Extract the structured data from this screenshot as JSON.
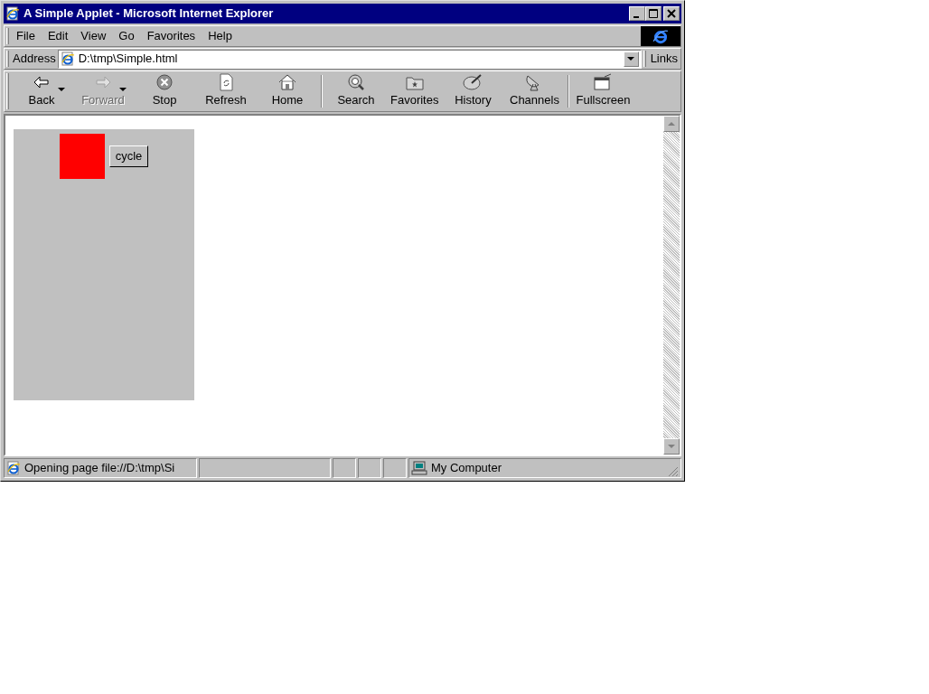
{
  "window": {
    "title": "A Simple Applet - Microsoft Internet Explorer"
  },
  "menu": [
    {
      "label": "File"
    },
    {
      "label": "Edit"
    },
    {
      "label": "View"
    },
    {
      "label": "Go"
    },
    {
      "label": "Favorites"
    },
    {
      "label": "Help"
    }
  ],
  "address": {
    "label": "Address",
    "value": "D:\\tmp\\Simple.html"
  },
  "links": "Links",
  "toolbar": [
    [
      {
        "label": "Back",
        "disabled": false,
        "has_menu": true
      },
      {
        "label": "Forward",
        "disabled": true,
        "has_menu": true
      },
      {
        "label": "Stop",
        "disabled": false,
        "has_menu": false
      },
      {
        "label": "Refresh",
        "disabled": false,
        "has_menu": false
      },
      {
        "label": "Home",
        "disabled": false,
        "has_menu": false
      }
    ],
    [
      {
        "label": "Search",
        "disabled": false,
        "has_menu": false
      },
      {
        "label": "Favorites",
        "disabled": false,
        "has_menu": false
      },
      {
        "label": "History",
        "disabled": false,
        "has_menu": false
      },
      {
        "label": "Channels",
        "disabled": false,
        "has_menu": false
      }
    ],
    [
      {
        "label": "Fullscreen",
        "disabled": false,
        "has_menu": false
      }
    ]
  ],
  "applet": {
    "button": "cycle"
  },
  "status_bar": {
    "text": "Opening page file://D:\\tmp\\Si",
    "zone": "My Computer"
  }
}
